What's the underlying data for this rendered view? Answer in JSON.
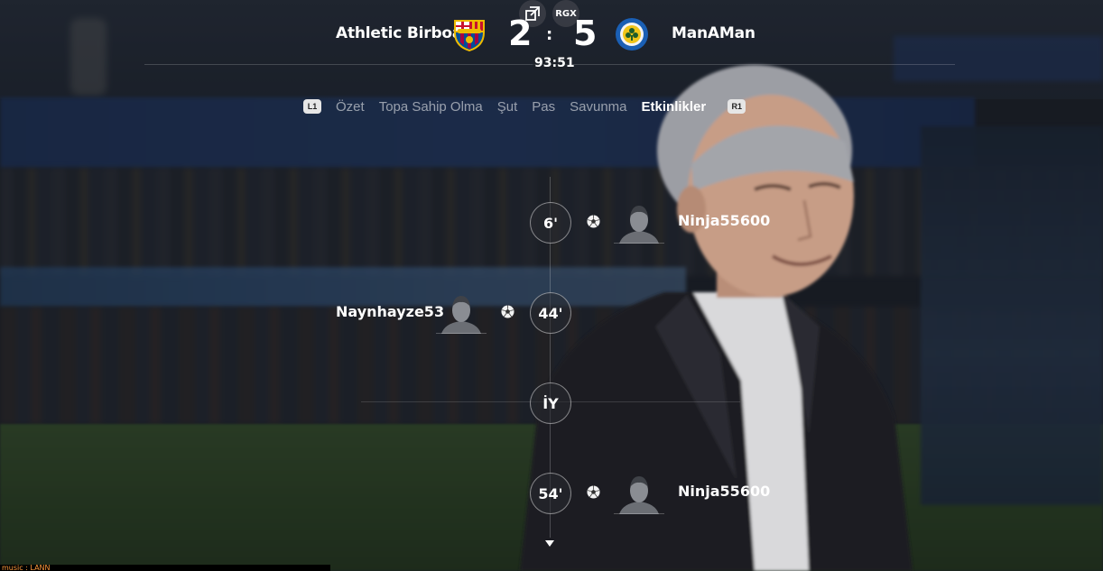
{
  "match": {
    "home_team": "Athletic Birboa",
    "away_team": "ManAMan",
    "home_score": "2",
    "away_score": "5",
    "score_separator": ":",
    "clock": "93:51",
    "rgx_label": "RGX"
  },
  "tabs": {
    "left_bumper": "L1",
    "right_bumper": "R1",
    "items": [
      "Özet",
      "Topa Sahip Olma",
      "Şut",
      "Pas",
      "Savunma",
      "Etkinlikler"
    ],
    "active": "Etkinlikler"
  },
  "events": [
    {
      "minute": "6'",
      "player": "Ninja55600",
      "side": "away",
      "type": "goal"
    },
    {
      "minute": "44'",
      "player": "Naynhayze53",
      "side": "home",
      "type": "goal"
    },
    {
      "minute": "İY",
      "player": "",
      "side": "center",
      "type": "half-time"
    },
    {
      "minute": "54'",
      "player": "Ninja55600",
      "side": "away",
      "type": "goal"
    }
  ],
  "icons": {
    "popout": "popout-icon",
    "goal": "soccer-ball-icon",
    "avatar": "player-avatar-icon",
    "more": "chevron-down-icon"
  },
  "colors": {
    "home_crest_red": "#a50044",
    "home_crest_blue": "#004d98",
    "home_crest_gold": "#edbb00",
    "away_crest_blue": "#1a5fb4"
  },
  "footer": {
    "strip_text": "music : LANN"
  }
}
